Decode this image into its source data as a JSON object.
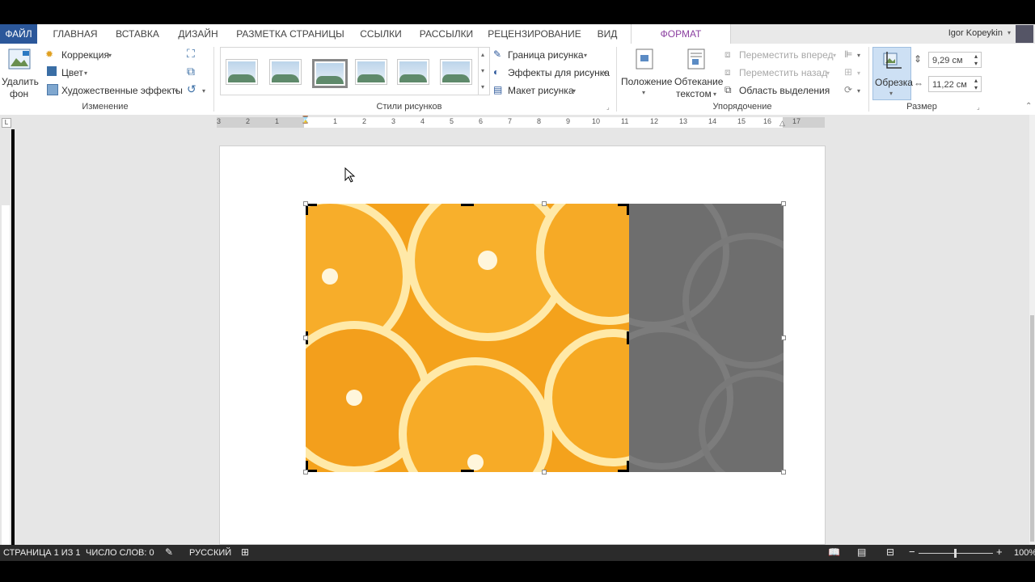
{
  "tabs": [
    {
      "label": "ФАЙЛ",
      "name": "tab-file"
    },
    {
      "label": "ГЛАВНАЯ",
      "name": "tab-home"
    },
    {
      "label": "ВСТАВКА",
      "name": "tab-insert"
    },
    {
      "label": "ДИЗАЙН",
      "name": "tab-design"
    },
    {
      "label": "РАЗМЕТКА СТРАНИЦЫ",
      "name": "tab-layout"
    },
    {
      "label": "ССЫЛКИ",
      "name": "tab-references"
    },
    {
      "label": "РАССЫЛКИ",
      "name": "tab-mailings"
    },
    {
      "label": "РЕЦЕНЗИРОВАНИЕ",
      "name": "tab-review"
    },
    {
      "label": "ВИД",
      "name": "tab-view"
    },
    {
      "label": "ФОРМАТ",
      "name": "tab-format"
    }
  ],
  "user": {
    "name": "Igor Kopeykin"
  },
  "ribbon": {
    "remove_bg": {
      "line1": "Удалить",
      "line2": "фон"
    },
    "adjust": {
      "correction": "Коррекция",
      "color": "Цвет",
      "art_effects": "Художественные эффекты",
      "group": "Изменение"
    },
    "styles": {
      "group": "Стили рисунков",
      "border": "Граница рисунка",
      "effects": "Эффекты для рисунка",
      "layout": "Макет рисунка"
    },
    "arrange": {
      "position": "Положение",
      "wrap_line1": "Обтекание",
      "wrap_line2": "текстом",
      "forward": "Переместить вперед",
      "backward": "Переместить назад",
      "selection": "Область выделения",
      "group": "Упорядочение"
    },
    "size": {
      "crop": "Обрезка",
      "height": "9,29 см",
      "width": "11,22 см",
      "group": "Размер"
    }
  },
  "ruler": {
    "numbers": [
      "3",
      "2",
      "1",
      "1",
      "2",
      "3",
      "4",
      "5",
      "6",
      "7",
      "8",
      "9",
      "10",
      "11",
      "12",
      "13",
      "14",
      "15",
      "16",
      "17"
    ]
  },
  "status": {
    "page": "СТРАНИЦА 1 ИЗ 1",
    "words": "ЧИСЛО СЛОВ: 0",
    "language": "РУССКИЙ",
    "zoom": "100%"
  },
  "colors": {
    "file_tab": "#2b579a",
    "format_tab_text": "#8b3fa0",
    "status_bar": "#2b2b2b",
    "orange": "#f5a623"
  }
}
